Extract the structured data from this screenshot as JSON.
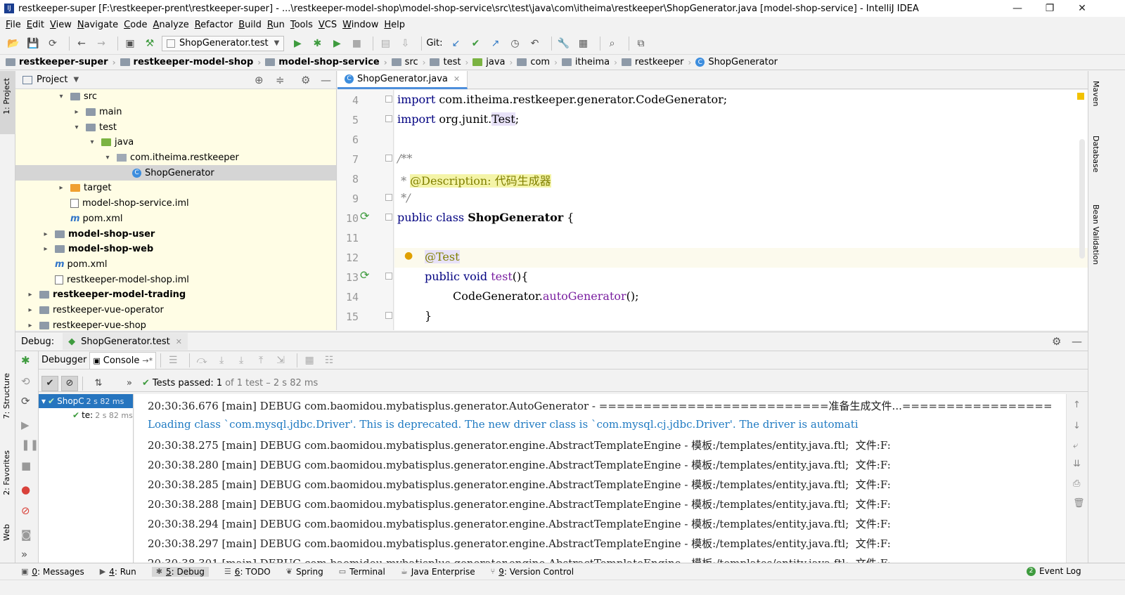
{
  "window": {
    "title": "restkeeper-super [F:\\restkeeper-prent\\restkeeper-super] - ...\\restkeeper-model-shop\\model-shop-service\\src\\test\\java\\com\\itheima\\restkeeper\\ShopGenerator.java [model-shop-service] - IntelliJ IDEA",
    "app_icon": "IJ"
  },
  "menu": [
    "File",
    "Edit",
    "View",
    "Navigate",
    "Code",
    "Analyze",
    "Refactor",
    "Build",
    "Run",
    "Tools",
    "VCS",
    "Window",
    "Help"
  ],
  "toolbar": {
    "run_config": "ShopGenerator.test",
    "git_label": "Git:"
  },
  "breadcrumbs": [
    {
      "label": "restkeeper-super",
      "bold": true
    },
    {
      "label": "restkeeper-model-shop",
      "bold": true
    },
    {
      "label": "model-shop-service",
      "bold": true
    },
    {
      "label": "src",
      "bold": false
    },
    {
      "label": "test",
      "bold": false
    },
    {
      "label": "java",
      "bold": false
    },
    {
      "label": "com",
      "bold": false
    },
    {
      "label": "itheima",
      "bold": false
    },
    {
      "label": "restkeeper",
      "bold": false
    },
    {
      "label": "ShopGenerator",
      "bold": false
    }
  ],
  "left_strip": {
    "project": "1: Project",
    "structure": "7: Structure",
    "favorites": "2: Favorites",
    "web": "Web"
  },
  "right_strip": {
    "maven": "Maven",
    "database": "Database",
    "bean": "Bean Validation"
  },
  "project_panel": {
    "title": "Project",
    "tree": [
      {
        "label": "src",
        "indent": 3,
        "arrow": "down",
        "icon": "folder"
      },
      {
        "label": "main",
        "indent": 4,
        "arrow": "right",
        "icon": "folder"
      },
      {
        "label": "test",
        "indent": 4,
        "arrow": "down",
        "icon": "folder"
      },
      {
        "label": "java",
        "indent": 5,
        "arrow": "down",
        "icon": "java"
      },
      {
        "label": "com.itheima.restkeeper",
        "indent": 6,
        "arrow": "down",
        "icon": "pkg"
      },
      {
        "label": "ShopGenerator",
        "indent": 7,
        "arrow": "",
        "icon": "class",
        "selected": true
      },
      {
        "label": "target",
        "indent": 3,
        "arrow": "right",
        "icon": "orange"
      },
      {
        "label": "model-shop-service.iml",
        "indent": 3,
        "arrow": "",
        "icon": "iml"
      },
      {
        "label": "pom.xml",
        "indent": 3,
        "arrow": "",
        "icon": "maven"
      },
      {
        "label": "model-shop-user",
        "indent": 2,
        "arrow": "right",
        "icon": "folder",
        "bold": true
      },
      {
        "label": "model-shop-web",
        "indent": 2,
        "arrow": "right",
        "icon": "folder",
        "bold": true
      },
      {
        "label": "pom.xml",
        "indent": 2,
        "arrow": "",
        "icon": "maven"
      },
      {
        "label": "restkeeper-model-shop.iml",
        "indent": 2,
        "arrow": "",
        "icon": "iml"
      },
      {
        "label": "restkeeper-model-trading",
        "indent": 1,
        "arrow": "right",
        "icon": "folder",
        "bold": true
      },
      {
        "label": "restkeeper-vue-operator",
        "indent": 1,
        "arrow": "right",
        "icon": "folder"
      },
      {
        "label": "restkeeper-vue-shop",
        "indent": 1,
        "arrow": "right",
        "icon": "folder"
      }
    ]
  },
  "editor": {
    "tab": "ShopGenerator.java",
    "line_numbers": [
      "4",
      "5",
      "6",
      "7",
      "8",
      "9",
      "10",
      "11",
      "12",
      "13",
      "14",
      "15"
    ]
  },
  "debug": {
    "label": "Debug:",
    "tab": "ShopGenerator.test",
    "subtabs": [
      "Debugger",
      "Console"
    ],
    "tests_passed": "Tests passed:",
    "tests_count": "1",
    "tests_rest": "of 1 test – 2 s 82 ms",
    "test_tree": [
      {
        "label": "ShopC",
        "time": "2 s 82 ms",
        "selected": true
      },
      {
        "label": "te:",
        "time": "2 s 82 ms",
        "selected": false
      }
    ],
    "console_lines": [
      {
        "text": "20:30:36.676 [main] DEBUG com.baomidou.mybatisplus.generator.AutoGenerator - ==========================准备生成文件...=================",
        "kind": "debug"
      },
      {
        "text": "Loading class `com.mysql.jdbc.Driver'. This is deprecated. The new driver class is `com.mysql.cj.jdbc.Driver'. The driver is automati",
        "kind": "info"
      },
      {
        "text": "20:30:38.275 [main] DEBUG com.baomidou.mybatisplus.generator.engine.AbstractTemplateEngine - 模板:/templates/entity.java.ftl;  文件:F:",
        "kind": "debug"
      },
      {
        "text": "20:30:38.280 [main] DEBUG com.baomidou.mybatisplus.generator.engine.AbstractTemplateEngine - 模板:/templates/entity.java.ftl;  文件:F:",
        "kind": "debug"
      },
      {
        "text": "20:30:38.285 [main] DEBUG com.baomidou.mybatisplus.generator.engine.AbstractTemplateEngine - 模板:/templates/entity.java.ftl;  文件:F:",
        "kind": "debug"
      },
      {
        "text": "20:30:38.288 [main] DEBUG com.baomidou.mybatisplus.generator.engine.AbstractTemplateEngine - 模板:/templates/entity.java.ftl;  文件:F:",
        "kind": "debug"
      },
      {
        "text": "20:30:38.294 [main] DEBUG com.baomidou.mybatisplus.generator.engine.AbstractTemplateEngine - 模板:/templates/entity.java.ftl;  文件:F:",
        "kind": "debug"
      },
      {
        "text": "20:30:38.297 [main] DEBUG com.baomidou.mybatisplus.generator.engine.AbstractTemplateEngine - 模板:/templates/entity.java.ftl;  文件:F:",
        "kind": "debug"
      },
      {
        "text": "20:30:38.301 [main] DEBUG com.baomidou.mybatisplus.generator.engine.AbstractTemplateEngine - 模板:/templates/entity.java.ftl;  文件:F:",
        "kind": "debug"
      }
    ]
  },
  "statusbar": [
    {
      "num": "0",
      "label": ": Messages",
      "icon": "▣"
    },
    {
      "num": "4",
      "label": ": Run",
      "icon": "▶"
    },
    {
      "num": "5",
      "label": ": Debug",
      "icon": "✱",
      "active": true
    },
    {
      "num": "6",
      "label": ": TODO",
      "icon": "☰"
    },
    {
      "num": "",
      "label": "Spring",
      "icon": "❦"
    },
    {
      "num": "",
      "label": "Terminal",
      "icon": "▭"
    },
    {
      "num": "",
      "label": "Java Enterprise",
      "icon": "☕"
    },
    {
      "num": "9",
      "label": ": Version Control",
      "icon": "⑂"
    }
  ],
  "event_log": {
    "count": "2",
    "label": "Event Log"
  }
}
